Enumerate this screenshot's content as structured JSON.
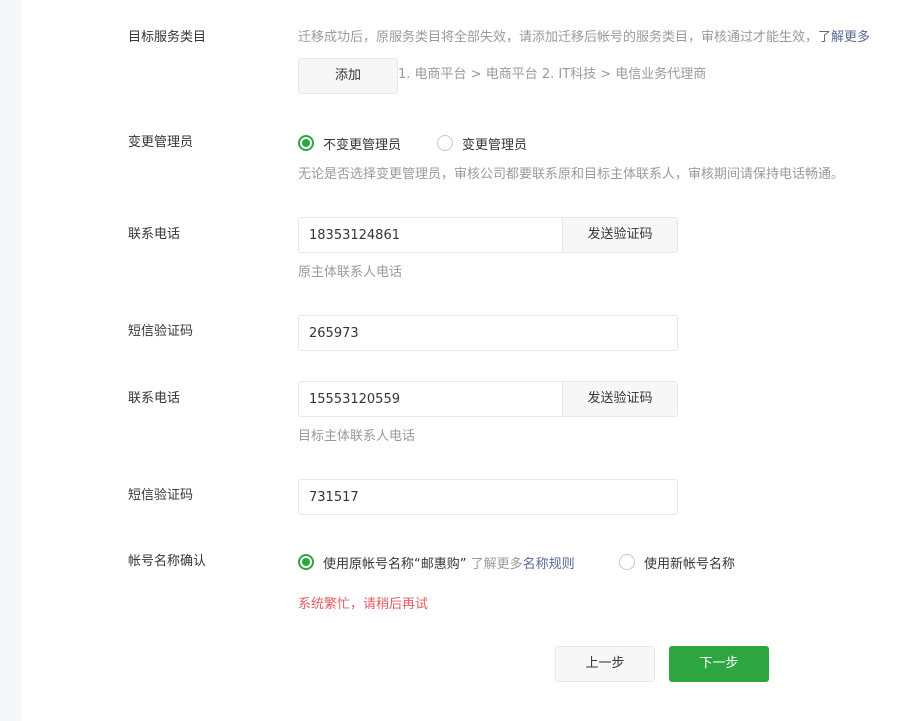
{
  "service_category": {
    "label": "目标服务类目",
    "tip": "迁移成功后，原服务类目将全部失效，请添加迁移后帐号的服务类目，审核通过才能生效，",
    "tip_link": "了解更多",
    "add_button": "添加",
    "category_path": "1. 电商平台 > 电商平台   2. IT科技 > 电信业务代理商"
  },
  "admin": {
    "label": "变更管理员",
    "option_keep": "不变更管理员",
    "option_change": "变更管理员",
    "selected": "keep",
    "hint": "无论是否选择变更管理员，审核公司都要联系原和目标主体联系人，审核期间请保持电话畅通。"
  },
  "original_contact": {
    "phone_label": "联系电话",
    "phone_value": "18353124861",
    "send_code": "发送验证码",
    "phone_hint": "原主体联系人电话",
    "sms_label": "短信验证码",
    "sms_value": "265973"
  },
  "target_contact": {
    "phone_label": "联系电话",
    "phone_value": "15553120559",
    "send_code": "发送验证码",
    "phone_hint": "目标主体联系人电话",
    "sms_label": "短信验证码",
    "sms_value": "731517"
  },
  "account_name": {
    "label": "帐号名称确认",
    "option_original_prefix": "使用原帐号名称“邮惠购”",
    "option_original_more": " 了解更多",
    "option_original_link": "名称规则",
    "option_new": "使用新帐号名称",
    "selected": "original"
  },
  "error_message": "系统繁忙，请稍后再试",
  "buttons": {
    "prev": "上一步",
    "next": "下一步"
  },
  "colors": {
    "accent": "#2da641",
    "link": "#576b95",
    "error": "#e15f63"
  }
}
